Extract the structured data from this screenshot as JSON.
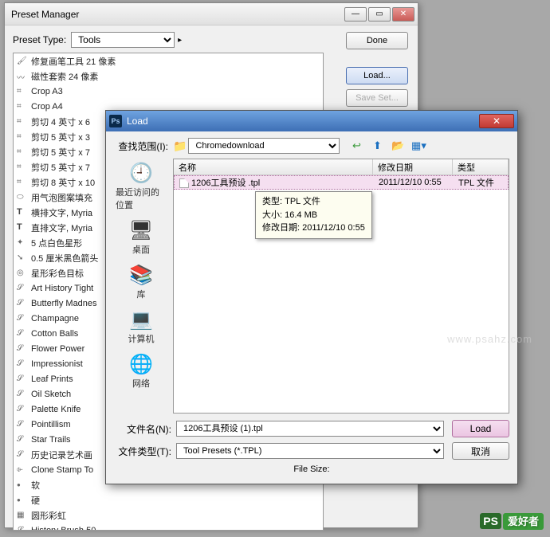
{
  "pm": {
    "title": "Preset Manager",
    "preset_type_label": "Preset Type:",
    "preset_type_value": "Tools",
    "buttons": {
      "done": "Done",
      "load": "Load...",
      "save": "Save Set..."
    },
    "items": [
      {
        "icon": "brush",
        "label": "修复画笔工具 21 像素"
      },
      {
        "icon": "lasso",
        "label": "磁性套索 24 像素"
      },
      {
        "icon": "crop",
        "label": "Crop A3"
      },
      {
        "icon": "crop",
        "label": "Crop A4"
      },
      {
        "icon": "crop",
        "label": "剪切 4 英寸 x 6"
      },
      {
        "icon": "crop",
        "label": "剪切 5 英寸 x 3"
      },
      {
        "icon": "crop",
        "label": "剪切 5 英寸 x 7"
      },
      {
        "icon": "crop",
        "label": "剪切 5 英寸 x 7"
      },
      {
        "icon": "crop",
        "label": "剪切 8 英寸 x 10"
      },
      {
        "icon": "bubble",
        "label": "用气泡图案填充"
      },
      {
        "icon": "text",
        "label": "横排文字, Myria"
      },
      {
        "icon": "text",
        "label": "直排文字, Myria"
      },
      {
        "icon": "star",
        "label": "5 点白色星形"
      },
      {
        "icon": "arrow",
        "label": "0.5 厘米黑色箭头"
      },
      {
        "icon": "target",
        "label": "星形彩色目标"
      },
      {
        "icon": "art",
        "label": "Art History Tight"
      },
      {
        "icon": "art",
        "label": "Butterfly Madnes"
      },
      {
        "icon": "art",
        "label": "Champagne"
      },
      {
        "icon": "art",
        "label": "Cotton Balls"
      },
      {
        "icon": "art",
        "label": "Flower Power"
      },
      {
        "icon": "art",
        "label": "Impressionist"
      },
      {
        "icon": "art",
        "label": "Leaf Prints"
      },
      {
        "icon": "art",
        "label": "Oil Sketch"
      },
      {
        "icon": "art",
        "label": "Palette Knife"
      },
      {
        "icon": "art",
        "label": "Pointillism"
      },
      {
        "icon": "art",
        "label": "Star Trails"
      },
      {
        "icon": "art",
        "label": "历史记录艺术画"
      },
      {
        "icon": "stamp",
        "label": "Clone Stamp To"
      },
      {
        "icon": "dot",
        "label": "软"
      },
      {
        "icon": "dot",
        "label": "硬"
      },
      {
        "icon": "square",
        "label": "圆形彩虹"
      },
      {
        "icon": "art",
        "label": "History Brush 50"
      }
    ]
  },
  "load": {
    "title": "Load",
    "lookin_label": "查找范围(I):",
    "lookin_value": "Chromedownload",
    "columns": {
      "name": "名称",
      "date": "修改日期",
      "type": "类型"
    },
    "file": {
      "name": "1206工具预设 .tpl",
      "date": "2011/12/10 0:55",
      "type": "TPL 文件"
    },
    "tooltip": {
      "type": "类型: TPL 文件",
      "size": "大小: 16.4 MB",
      "date": "修改日期: 2011/12/10 0:55"
    },
    "places": {
      "recent": "最近访问的位置",
      "desktop": "桌面",
      "library": "库",
      "computer": "计算机",
      "network": "网络"
    },
    "filename_label": "文件名(N):",
    "filename_value": "1206工具预设 (1).tpl",
    "filetype_label": "文件类型(T):",
    "filetype_value": "Tool Presets (*.TPL)",
    "buttons": {
      "load": "Load",
      "cancel": "取消"
    },
    "filesize_label": "File Size:"
  },
  "watermark": {
    "url": "www.psahz.com",
    "brand_ps": "PS",
    "brand_zh": "爱好者"
  }
}
